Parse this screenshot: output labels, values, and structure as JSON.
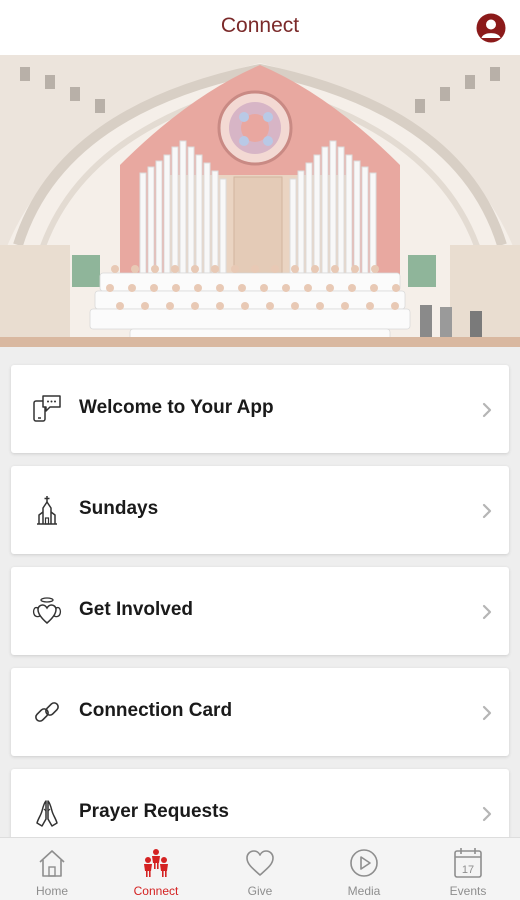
{
  "header": {
    "title": "Connect",
    "profile_icon": "user-profile-icon"
  },
  "hero": {
    "description_icon": "church-choir-photo"
  },
  "menu": {
    "items": [
      {
        "label": "Welcome to Your App",
        "icon": "message-phone-icon"
      },
      {
        "label": "Sundays",
        "icon": "church-icon"
      },
      {
        "label": "Get Involved",
        "icon": "angel-heart-icon"
      },
      {
        "label": "Connection Card",
        "icon": "link-icon"
      },
      {
        "label": "Prayer Requests",
        "icon": "praying-hands-icon"
      }
    ]
  },
  "tabbar": {
    "tabs": [
      {
        "label": "Home",
        "icon": "home-icon",
        "active": false
      },
      {
        "label": "Connect",
        "icon": "people-icon",
        "active": true
      },
      {
        "label": "Give",
        "icon": "heart-icon",
        "active": false
      },
      {
        "label": "Media",
        "icon": "play-icon",
        "active": false
      },
      {
        "label": "Events",
        "icon": "calendar-icon",
        "active": false,
        "badge_text": "17"
      }
    ]
  },
  "colors": {
    "accent": "#d42222",
    "title": "#7b2a2a",
    "inactive": "#8e8e8e"
  }
}
